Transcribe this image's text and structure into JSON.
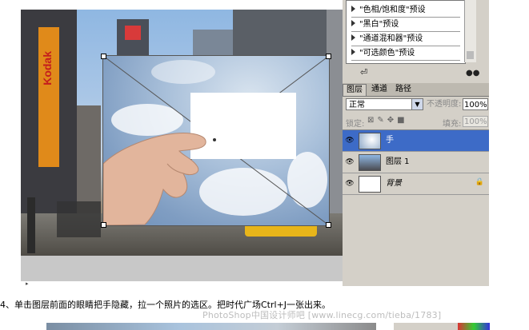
{
  "adjustments": {
    "items": [
      {
        "label": "\"色相/饱和度\"预设"
      },
      {
        "label": "\"黑白\"预设"
      },
      {
        "label": "\"通道混和器\"预设"
      },
      {
        "label": "\"可选颜色\"预设"
      }
    ]
  },
  "layers_panel": {
    "tabs": [
      "图层",
      "通道",
      "路径"
    ],
    "active_tab": "图层",
    "blend_mode": "正常",
    "opacity_label": "不透明度:",
    "opacity_value": "100%",
    "lock_label": "锁定:",
    "fill_label": "填充:",
    "fill_value": "100%",
    "layers": [
      {
        "name": "手",
        "selected": true
      },
      {
        "name": "图层 1",
        "selected": false
      },
      {
        "name": "背景",
        "selected": false
      }
    ]
  },
  "billboard_text": "Kodak",
  "caption": "4、单击图层前面的眼睛把手隐藏，拉一个照片的选区。把时代广场Ctrl+J一张出来。",
  "watermark": "PhotoShop中国设计师吧 [www.linecg.com/tieba/1783]",
  "colors": {
    "selected_layer": "#3d6bc7",
    "panel_bg": "#d4d0c8",
    "canvas_gray": "#c8c8c8"
  }
}
